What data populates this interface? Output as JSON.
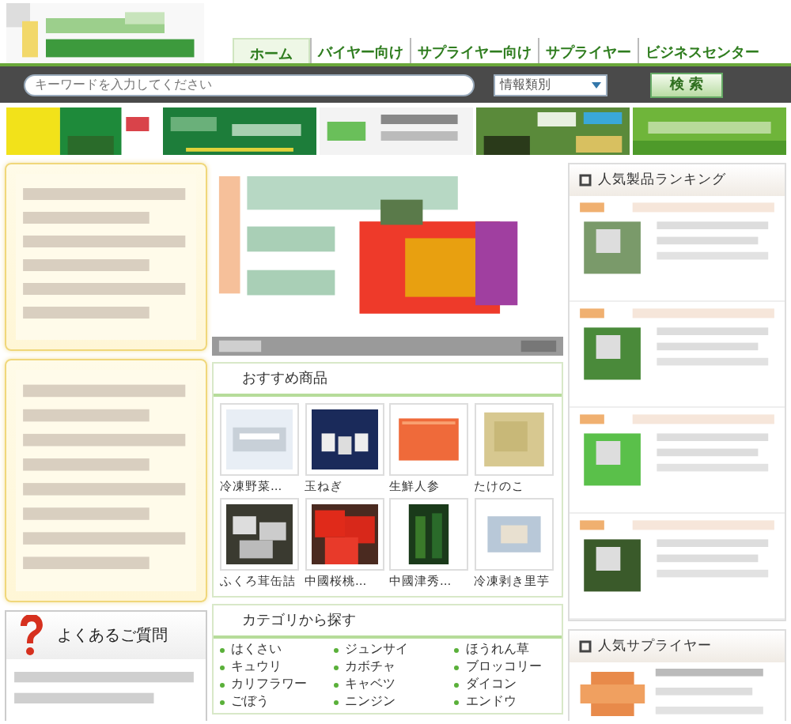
{
  "nav_tabs": [
    {
      "label": "ホーム",
      "selected": true
    },
    {
      "label": "バイヤー向け",
      "selected": false
    },
    {
      "label": "サプライヤー向け",
      "selected": false
    },
    {
      "label": "サプライヤー",
      "selected": false
    },
    {
      "label": "ビジネスセンター",
      "selected": false
    }
  ],
  "search": {
    "placeholder": "キーワードを入力してください",
    "category": "情報類別",
    "button": "検 索"
  },
  "recommended": {
    "title": "おすすめ商品",
    "products": [
      {
        "name": "冷凍野菜..."
      },
      {
        "name": "玉ねぎ"
      },
      {
        "name": "生鮮人参"
      },
      {
        "name": "たけのこ"
      },
      {
        "name": "ふくろ茸缶詰"
      },
      {
        "name": "中國桜桃..."
      },
      {
        "name": "中國津秀..."
      },
      {
        "name": "冷凍剥き里芋"
      }
    ]
  },
  "categories": {
    "title": "カテゴリから探す",
    "items": [
      "はくさい",
      "ジュンサイ",
      "ほうれん草",
      "キュウリ",
      "カボチャ",
      "ブロッコリー",
      "カリフラワー",
      "キャベツ",
      "ダイコン",
      "ごぼう",
      "ニンジン",
      "エンドウ"
    ]
  },
  "faq": {
    "title": "よくあるご質問"
  },
  "ranking": {
    "title": "人気製品ランキング"
  },
  "suppliers": {
    "title": "人気サプライヤー"
  }
}
